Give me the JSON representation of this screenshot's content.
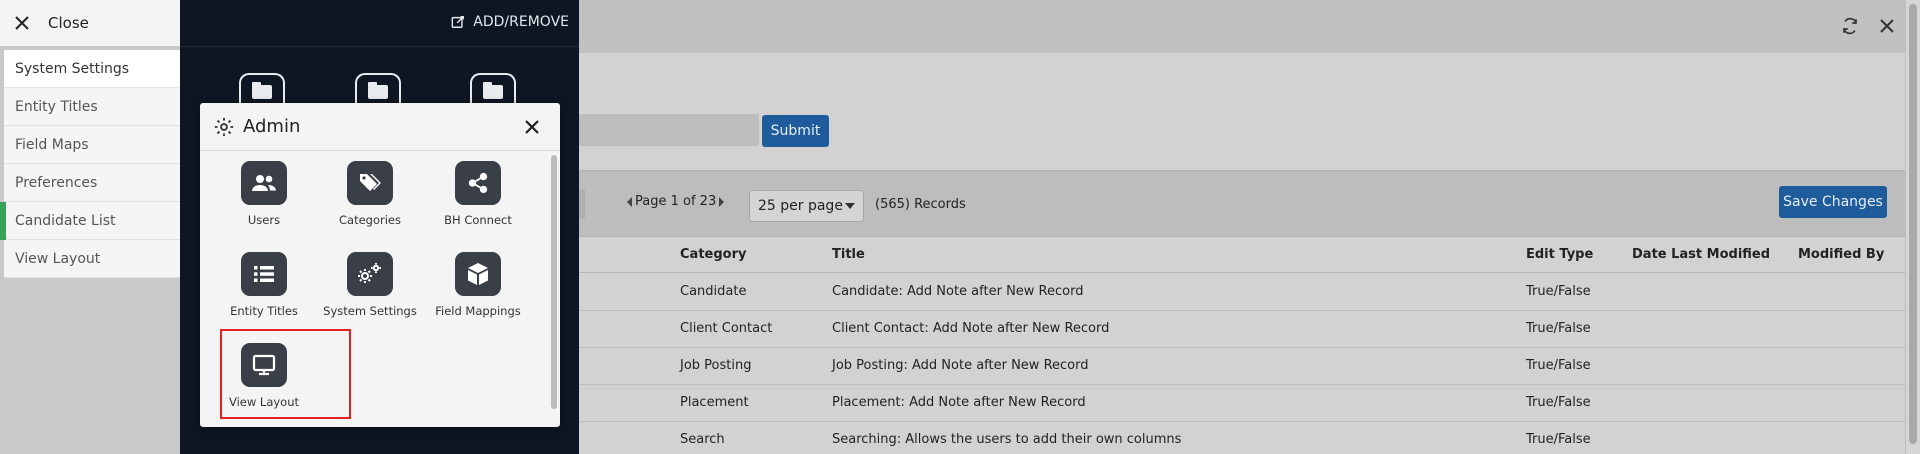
{
  "left_nav": {
    "close_label": "Close",
    "items": [
      {
        "label": "System Settings"
      },
      {
        "label": "Entity Titles"
      },
      {
        "label": "Field Maps"
      },
      {
        "label": "Preferences"
      },
      {
        "label": "Candidate List"
      },
      {
        "label": "View Layout"
      }
    ]
  },
  "dark_panel": {
    "add_remove_label": "ADD/REMOVE",
    "folder_icons": [
      "folder-icon",
      "folder-icon",
      "folder-icon"
    ]
  },
  "admin_popup": {
    "title": "Admin",
    "icon": "gear-icon",
    "tiles": [
      {
        "label": "Users",
        "icon": "users-icon"
      },
      {
        "label": "Categories",
        "icon": "tags-icon"
      },
      {
        "label": "BH Connect",
        "icon": "share-icon"
      },
      {
        "label": "Entity Titles",
        "icon": "list-icon"
      },
      {
        "label": "System Settings",
        "icon": "gears-icon"
      },
      {
        "label": "Field Mappings",
        "icon": "cube-icon"
      },
      {
        "label": "View Layout",
        "icon": "monitor-icon"
      }
    ],
    "highlighted_tile": "View Layout"
  },
  "main": {
    "submit_label": "Submit",
    "pager_text": "Page 1 of 23",
    "per_page": "25 per page",
    "records_text": "(565) Records",
    "save_label": "Save Changes",
    "columns": [
      "Category",
      "Title",
      "Edit Type",
      "Date Last Modified",
      "Modified By"
    ],
    "rows": [
      {
        "category": "Candidate",
        "title": "Candidate: Add Note after New Record",
        "edit_type": "True/False",
        "date": "",
        "modified_by": ""
      },
      {
        "category": "Client Contact",
        "title": "Client Contact: Add Note after New Record",
        "edit_type": "True/False",
        "date": "",
        "modified_by": ""
      },
      {
        "category": "Job Posting",
        "title": "Job Posting: Add Note after New Record",
        "edit_type": "True/False",
        "date": "",
        "modified_by": ""
      },
      {
        "category": "Placement",
        "title": "Placement: Add Note after New Record",
        "edit_type": "True/False",
        "date": "",
        "modified_by": ""
      },
      {
        "category": "Search",
        "title": "Searching: Allows the users to add their own columns",
        "edit_type": "True/False",
        "date": "",
        "modified_by": ""
      }
    ]
  },
  "colors": {
    "accent_blue": "#1f5c9c",
    "dark_panel": "#0e1624",
    "tile_icon_bg": "#3a3f47",
    "highlight": "#e0231f",
    "active_marker": "#3aa35a"
  }
}
